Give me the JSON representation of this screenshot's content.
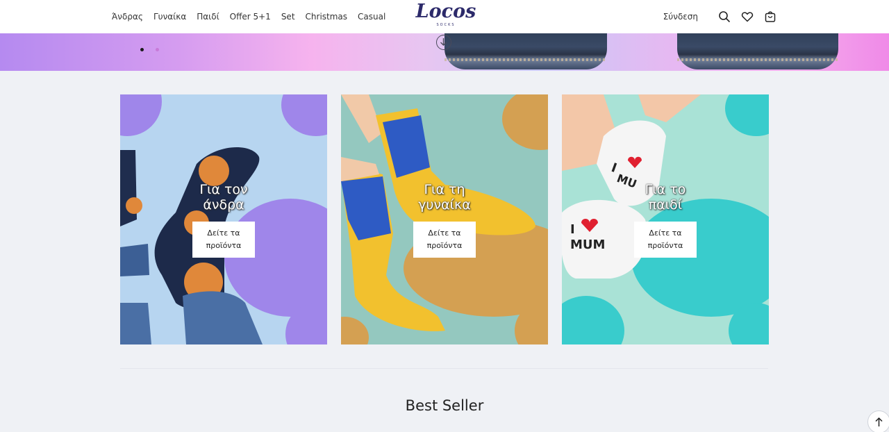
{
  "brand": {
    "logo_text": "Locos",
    "logo_sub": "SOCKS"
  },
  "nav": {
    "items": [
      {
        "label": "Άνδρας"
      },
      {
        "label": "Γυναίκα"
      },
      {
        "label": "Παιδί"
      },
      {
        "label": "Offer 5+1"
      },
      {
        "label": "Set"
      },
      {
        "label": "Christmas"
      },
      {
        "label": "Casual"
      }
    ]
  },
  "header": {
    "login_label": "Σύνδεση",
    "icons": [
      "search-icon",
      "heart-icon",
      "bag-icon"
    ]
  },
  "hero": {
    "slides_count": 2,
    "active_slide": 1,
    "dot_colors": [
      "#1a1a1a",
      "#c77ad8"
    ]
  },
  "categories": [
    {
      "title_line1": "Για τον",
      "title_line2": "άνδρα",
      "button_line1": "Δείτε τα",
      "button_line2": "προϊόντα"
    },
    {
      "title_line1": "Για τη",
      "title_line2": "γυναίκα",
      "button_line1": "Δείτε τα",
      "button_line2": "προϊόντα"
    },
    {
      "title_line1": "Για το",
      "title_line2": "παιδί",
      "button_line1": "Δείτε τα",
      "button_line2": "προϊόντα"
    }
  ],
  "sections": {
    "best_seller_title": "Best Seller"
  },
  "colors": {
    "accent": "#2c2a6a",
    "page_bg": "#eff1f5"
  }
}
